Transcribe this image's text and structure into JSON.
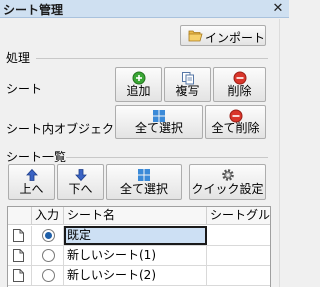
{
  "window": {
    "title": "シート管理",
    "close_glyph": "✕"
  },
  "import_button": {
    "label": "インポート",
    "icon": "folder-open-icon"
  },
  "process_section": {
    "label": "処理"
  },
  "sheet_row": {
    "label": "シート",
    "add_label": "追加",
    "copy_label": "複写",
    "delete_label": "削除"
  },
  "object_row": {
    "label": "シート内オブジェクト",
    "select_all_label": "全て選択",
    "delete_all_label": "全て削除"
  },
  "sheet_list_section": {
    "label": "シート一覧"
  },
  "list_toolbar": {
    "up_label": "上へ",
    "down_label": "下へ",
    "select_all_label": "全て選択",
    "quick_settings_label": "クイック設定"
  },
  "grid": {
    "columns": [
      "入力",
      "シート名",
      "シートグル"
    ],
    "rows": [
      {
        "selected": true,
        "name": "既定"
      },
      {
        "selected": false,
        "name": "新しいシート(1)"
      },
      {
        "selected": false,
        "name": "新しいシート(2)"
      }
    ]
  },
  "colors": {
    "title_bar": "#cfe0f1",
    "selection": "#cde0f4",
    "add_green": "#3aa635",
    "delete_red": "#d9362b",
    "grid_blue": "#3b8ad8"
  }
}
